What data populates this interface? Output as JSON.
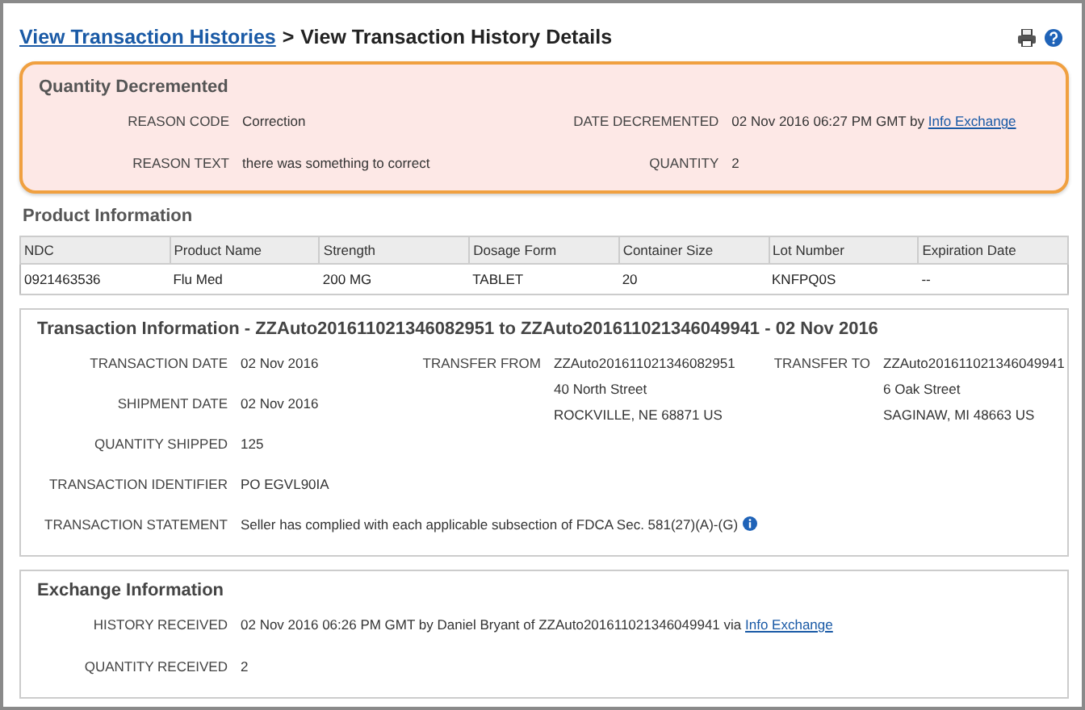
{
  "breadcrumb": {
    "link": "View Transaction Histories",
    "separator": ">",
    "current": "View Transaction History Details"
  },
  "quantity_decremented": {
    "title": "Quantity Decremented",
    "columns": [
      [
        {
          "label": "REASON CODE",
          "value": "Correction"
        },
        {
          "label": "REASON TEXT",
          "value": "there was something to correct"
        }
      ],
      [
        {
          "label": "DATE DECREMENTED",
          "value": "02 Nov 2016 06:27 PM GMT by",
          "link": "Info Exchange"
        },
        {
          "label": "QUANTITY",
          "value": "2"
        }
      ]
    ]
  },
  "product_information": {
    "title": "Product Information",
    "columns": [
      "NDC",
      "Product Name",
      "Strength",
      "Dosage Form",
      "Container Size",
      "Lot Number",
      "Expiration Date"
    ],
    "rows": [
      [
        "0921463536",
        "Flu Med",
        "200 MG",
        "TABLET",
        "20",
        "KNFPQ0S",
        "--"
      ]
    ]
  },
  "transaction_information": {
    "title": "Transaction Information - ZZAuto201611021346082951 to ZZAuto201611021346049941 - 02 Nov 2016",
    "columns": [
      [
        {
          "label": "TRANSACTION DATE",
          "lines": [
            "02 Nov 2016"
          ]
        },
        {
          "label": "SHIPMENT DATE",
          "lines": [
            "02 Nov 2016"
          ]
        },
        {
          "label": "QUANTITY SHIPPED",
          "lines": [
            "125"
          ]
        },
        {
          "label": "TRANSACTION IDENTIFIER",
          "lines": [
            "PO EGVL90IA"
          ]
        },
        {
          "label": "TRANSACTION STATEMENT",
          "lines": [
            "Seller has complied with each applicable subsection of FDCA Sec. 581(27)(A)-(G)"
          ],
          "info": true
        }
      ],
      [
        {
          "label": "TRANSFER FROM",
          "lines": [
            "ZZAuto201611021346082951",
            "40 North Street",
            "ROCKVILLE, NE 68871 US"
          ]
        }
      ],
      [
        {
          "label": "TRANSFER TO",
          "lines": [
            "ZZAuto201611021346049941",
            "6 Oak Street",
            "SAGINAW, MI 48663 US"
          ]
        }
      ]
    ]
  },
  "exchange_information": {
    "title": "Exchange Information",
    "fields": [
      {
        "label": "HISTORY RECEIVED",
        "value": "02 Nov 2016 06:26 PM GMT by Daniel Bryant of ZZAuto201611021346049941 via",
        "link": "Info Exchange"
      },
      {
        "label": "QUANTITY RECEIVED",
        "value": "2"
      }
    ]
  }
}
